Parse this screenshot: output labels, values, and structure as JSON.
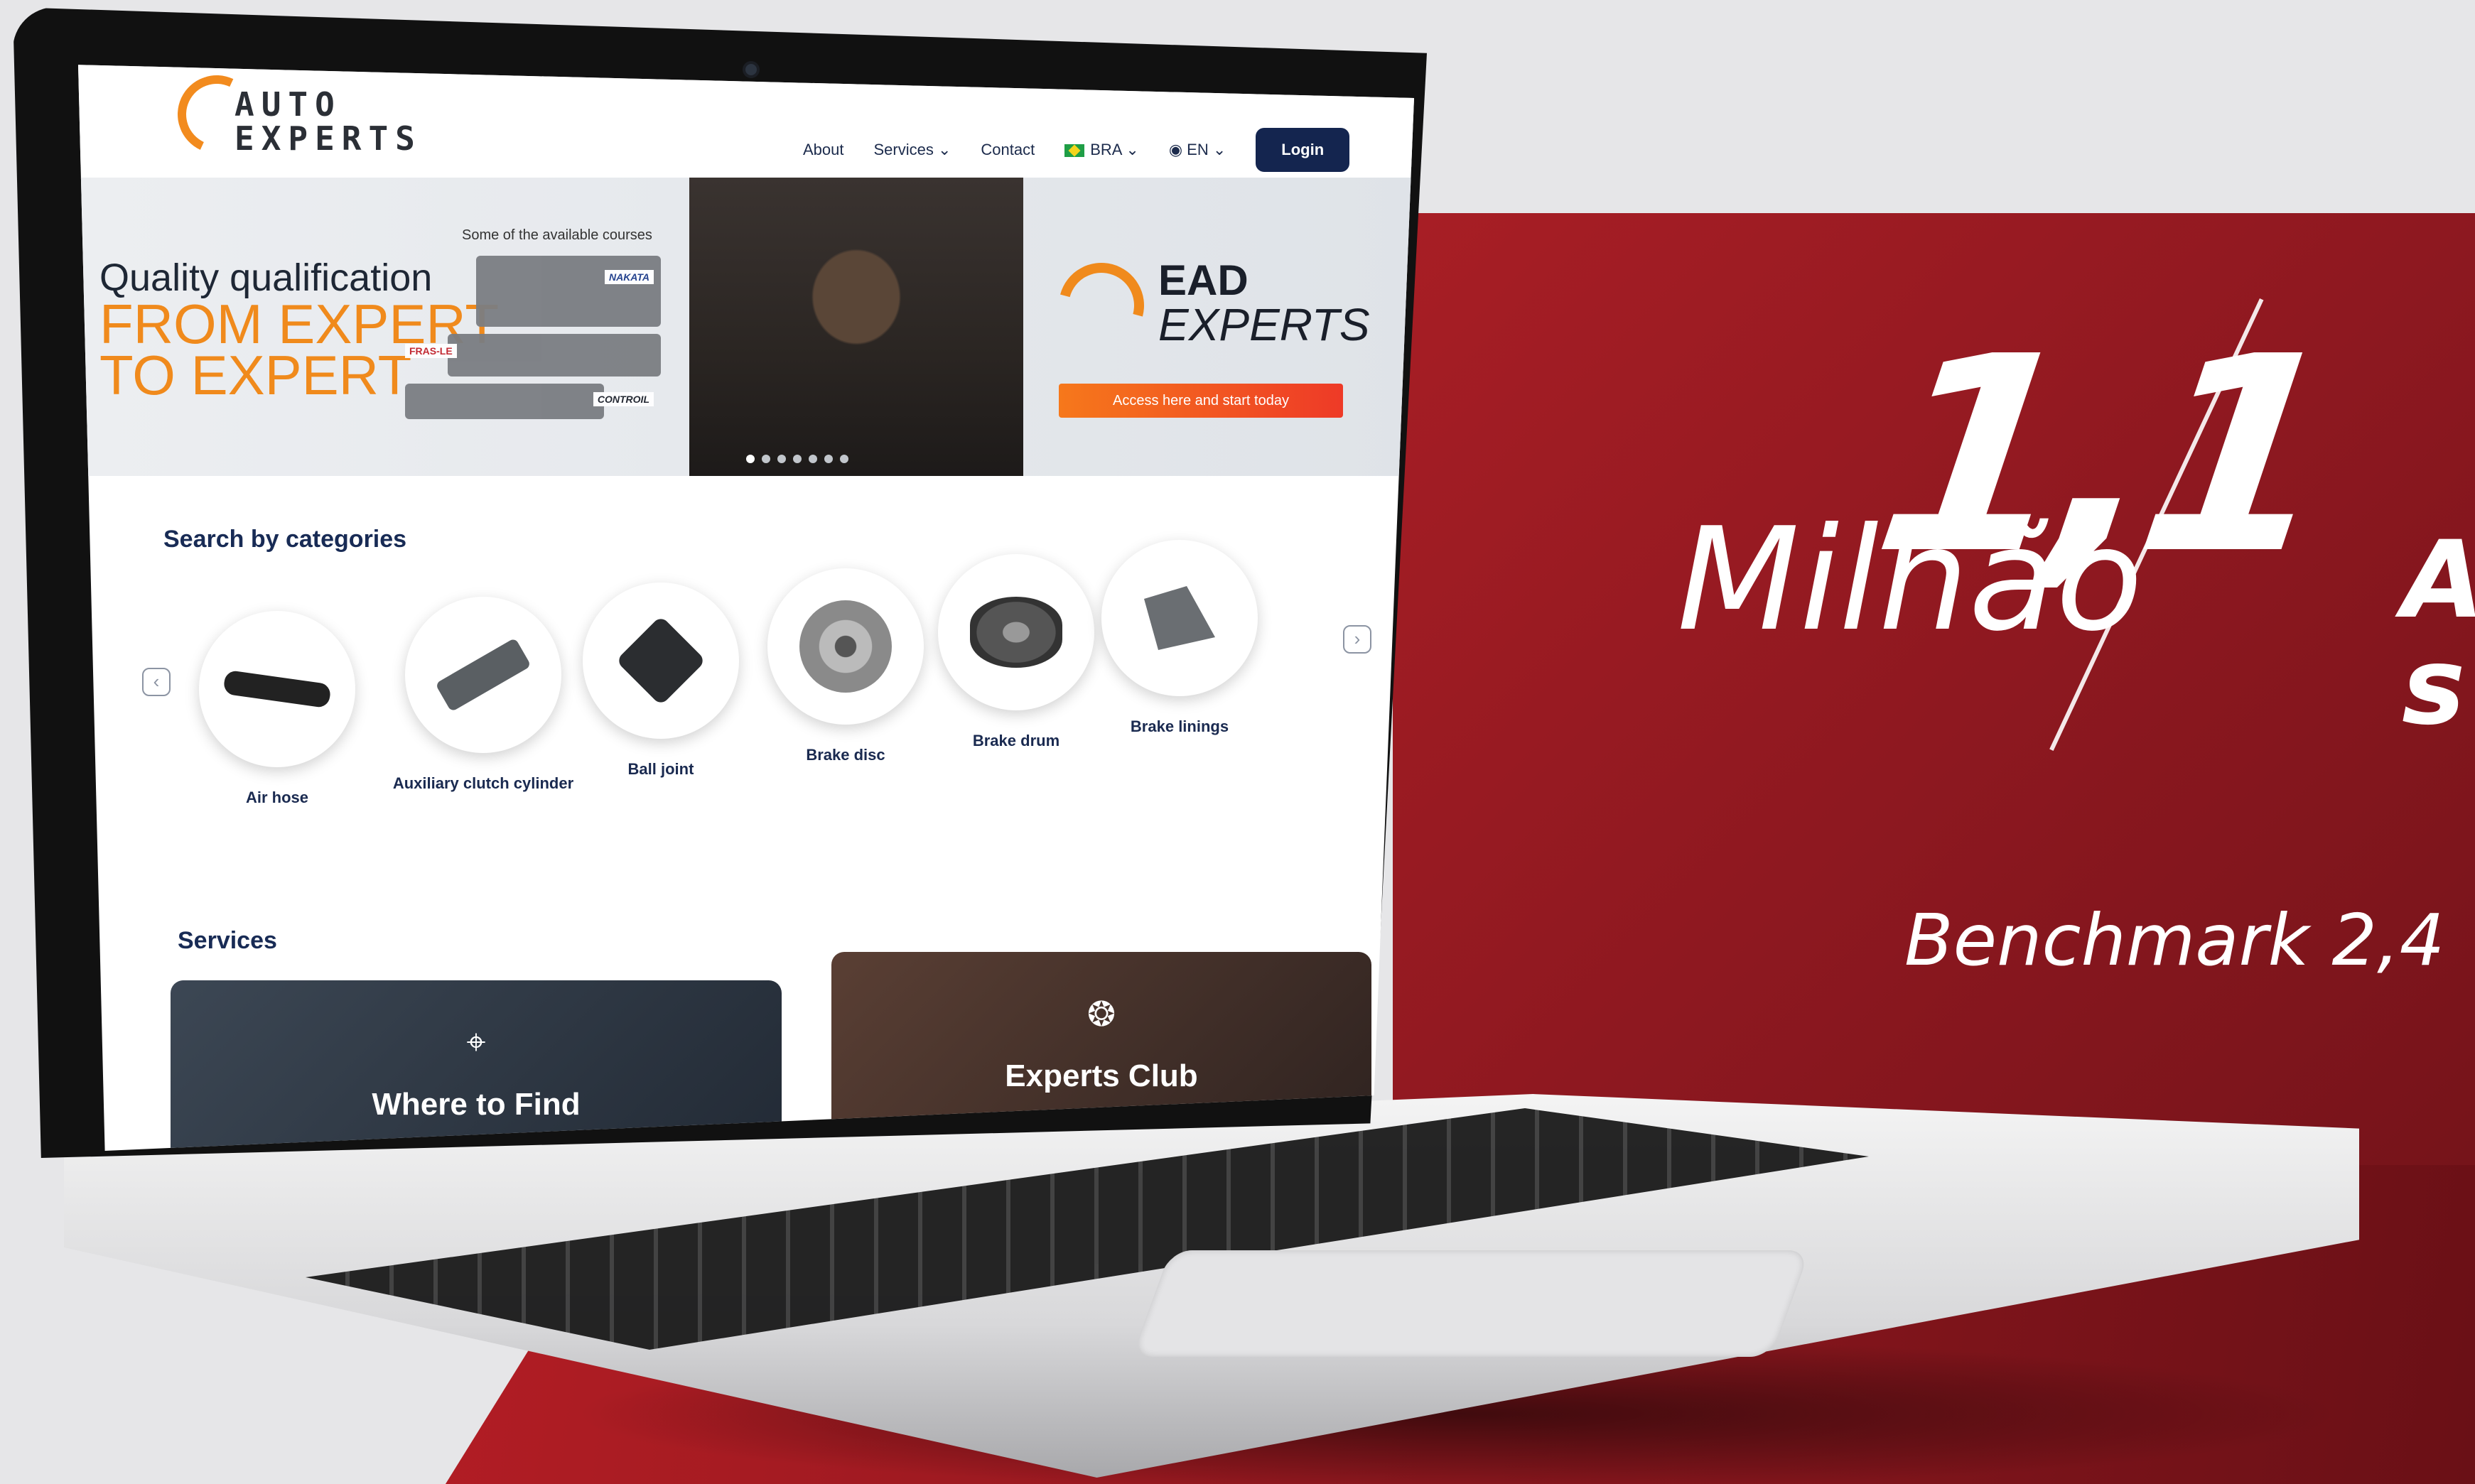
{
  "site": {
    "logo_line1": "AUTO",
    "logo_line2": "EXPERTS"
  },
  "nav": {
    "items": [
      "About",
      "Services",
      "Contact"
    ],
    "country": "BRA",
    "language": "EN",
    "login_label": "Login"
  },
  "hero": {
    "title_line1": "Quality qualification",
    "title_line2": "FROM EXPERT",
    "title_line3": "TO EXPERT",
    "courses_caption": "Some of the available courses",
    "ead_line1": "EAD",
    "ead_line2": "EXPERTS",
    "cta_label": "Access here and start today",
    "brand_1": "NAKATA",
    "brand_2": "FRAS-LE",
    "brand_3": "CONTROIL"
  },
  "categories": {
    "title": "Search by categories",
    "items": [
      "Air hose",
      "Auxiliary clutch cylinder",
      "Ball joint",
      "Brake disc",
      "Brake drum",
      "Brake linings"
    ],
    "prev_icon": "chevron-left-icon",
    "next_icon": "chevron-right-icon"
  },
  "services": {
    "title": "Services",
    "items": [
      {
        "name": "Where to Find",
        "icon": "location-pin-icon"
      },
      {
        "name": "Experts Club",
        "icon": "club-icon"
      }
    ]
  },
  "promo": {
    "big_number": "1,1",
    "unit": "Milhão",
    "right_fragment_1": "A",
    "right_fragment_2": "s",
    "benchmark": "Benchmark 2,4",
    "colors": {
      "red": "#a81e25",
      "orange": "#f08a1c",
      "navy": "#14254f"
    }
  }
}
